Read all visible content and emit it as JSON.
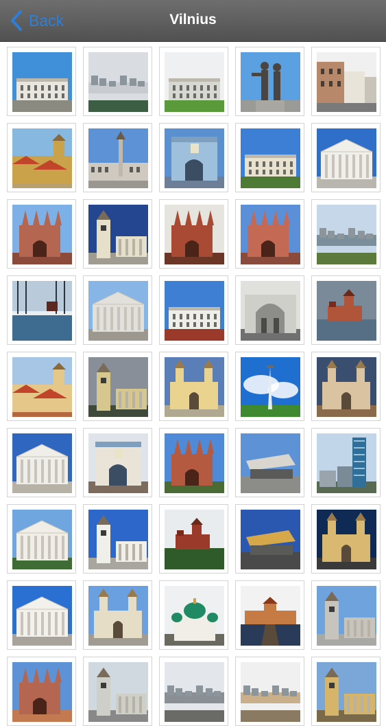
{
  "nav": {
    "back_label": "Back",
    "title": "Vilnius",
    "bar_color": "#5f5f5f",
    "accent": "#2f7fd8"
  },
  "photos": [
    {
      "sky": "#3f8fd9",
      "ground": "#8a8a80",
      "fill": "#e8e6de",
      "shape": "palace"
    },
    {
      "sky": "#d9dde2",
      "ground": "#3c5f44",
      "fill": "#c8ccd0",
      "shape": "city"
    },
    {
      "sky": "#eef0f2",
      "ground": "#5b9a3a",
      "fill": "#d8d8d2",
      "shape": "palace"
    },
    {
      "sky": "#5ba0e0",
      "ground": "#9a9a96",
      "fill": "#4a4540",
      "shape": "statue"
    },
    {
      "sky": "#f0f0f0",
      "ground": "#7a7a7a",
      "fill": "#b7896a",
      "shape": "street"
    },
    {
      "sky": "#87b8e0",
      "ground": "#b8a070",
      "fill": "#c9a24a",
      "shape": "roofs"
    },
    {
      "sky": "#5d93d6",
      "ground": "#9a9690",
      "fill": "#d0c9bf",
      "shape": "column"
    },
    {
      "sky": "#5a8fd0",
      "ground": "#6d7f98",
      "fill": "#9ec0dc",
      "shape": "gate"
    },
    {
      "sky": "#3d7fd4",
      "ground": "#4d7a34",
      "fill": "#e9e2cf",
      "shape": "palace"
    },
    {
      "sky": "#2f6fc9",
      "ground": "#b9b6b0",
      "fill": "#f1efe9",
      "shape": "temple"
    },
    {
      "sky": "#7db0e6",
      "ground": "#8b4a3a",
      "fill": "#b56650",
      "shape": "gothic"
    },
    {
      "sky": "#24458f",
      "ground": "#a09c92",
      "fill": "#e6dfc9",
      "shape": "tower"
    },
    {
      "sky": "#e6e4de",
      "ground": "#6b3626",
      "fill": "#a94b34",
      "shape": "gothic"
    },
    {
      "sky": "#5b8fd8",
      "ground": "#8a4b3c",
      "fill": "#c46a54",
      "shape": "gothic"
    },
    {
      "sky": "#c6d7ea",
      "ground": "#5b7a3b",
      "fill": "#7a8f9a",
      "shape": "city"
    },
    {
      "sky": "#b9cbdb",
      "ground": "#3e6b90",
      "fill": "#1e3b55",
      "shape": "winter"
    },
    {
      "sky": "#87b6e6",
      "ground": "#9c9890",
      "fill": "#e2e0da",
      "shape": "temple"
    },
    {
      "sky": "#3f7fd3",
      "ground": "#9b3a2a",
      "fill": "#f0eee8",
      "shape": "palace"
    },
    {
      "sky": "#e0e0dc",
      "ground": "#707070",
      "fill": "#cfcfc9",
      "shape": "arch"
    },
    {
      "sky": "#7a8a99",
      "ground": "#566f85",
      "fill": "#b0553a",
      "shape": "castle"
    },
    {
      "sky": "#a7c6e6",
      "ground": "#b5683e",
      "fill": "#e6c78a",
      "shape": "roofs"
    },
    {
      "sky": "#888f99",
      "ground": "#3f4a3a",
      "fill": "#d6c78f",
      "shape": "tower"
    },
    {
      "sky": "#5a7fb8",
      "ground": "#b0a890",
      "fill": "#e9d38f",
      "shape": "church"
    },
    {
      "sky": "#1f6fd0",
      "ground": "#3f8a30",
      "fill": "#e9ecef",
      "shape": "obelisk"
    },
    {
      "sky": "#3a4f70",
      "ground": "#8a6a4a",
      "fill": "#d9c3a0",
      "shape": "church"
    },
    {
      "sky": "#2f66c0",
      "ground": "#b6b2a6",
      "fill": "#f0eee8",
      "shape": "temple"
    },
    {
      "sky": "#dfe3ea",
      "ground": "#7d6b5e",
      "fill": "#e9e3d8",
      "shape": "gate"
    },
    {
      "sky": "#4e8ad8",
      "ground": "#4b6b34",
      "fill": "#b45a40",
      "shape": "gothic"
    },
    {
      "sky": "#5d93d6",
      "ground": "#8c8c88",
      "fill": "#d8d6cf",
      "shape": "modern"
    },
    {
      "sky": "#c2d6ea",
      "ground": "#586a52",
      "fill": "#2f6f9a",
      "shape": "skyscraper"
    },
    {
      "sky": "#6fa6e0",
      "ground": "#3f6b34",
      "fill": "#f0eee6",
      "shape": "temple"
    },
    {
      "sky": "#2d67c9",
      "ground": "#a9a6a0",
      "fill": "#f1efe9",
      "shape": "tower"
    },
    {
      "sky": "#e8ecef",
      "ground": "#2f5b2a",
      "fill": "#9a3a2a",
      "shape": "castle"
    },
    {
      "sky": "#2a57b0",
      "ground": "#4a4a4a",
      "fill": "#d6a84a",
      "shape": "modern"
    },
    {
      "sky": "#0f2a55",
      "ground": "#3a3a3a",
      "fill": "#d9b872",
      "shape": "church"
    },
    {
      "sky": "#2a6fd2",
      "ground": "#a8a49c",
      "fill": "#f3f1ec",
      "shape": "temple"
    },
    {
      "sky": "#6a9fe0",
      "ground": "#a09c94",
      "fill": "#e6ddc6",
      "shape": "church"
    },
    {
      "sky": "#eef0f2",
      "ground": "#6a6a60",
      "fill": "#1f8a64",
      "shape": "domes"
    },
    {
      "sky": "#f2f2f2",
      "ground": "#2a3b5a",
      "fill": "#c67a44",
      "shape": "bridge"
    },
    {
      "sky": "#6fa3de",
      "ground": "#a8a8a4",
      "fill": "#c7c3bd",
      "shape": "tower"
    },
    {
      "sky": "#5d93d6",
      "ground": "#c47a50",
      "fill": "#b56650",
      "shape": "gothic"
    },
    {
      "sky": "#d0d8e0",
      "ground": "#888",
      "fill": "#cfcfc9",
      "shape": "tower"
    },
    {
      "sky": "#e3e6ea",
      "ground": "#6a6a66",
      "fill": "#8a8f95",
      "shape": "city"
    },
    {
      "sky": "#f0f0f0",
      "ground": "#8b7a62",
      "fill": "#c9b08a",
      "shape": "city"
    },
    {
      "sky": "#7aa7d8",
      "ground": "#7a6a4a",
      "fill": "#d6b46a",
      "shape": "tower"
    }
  ]
}
